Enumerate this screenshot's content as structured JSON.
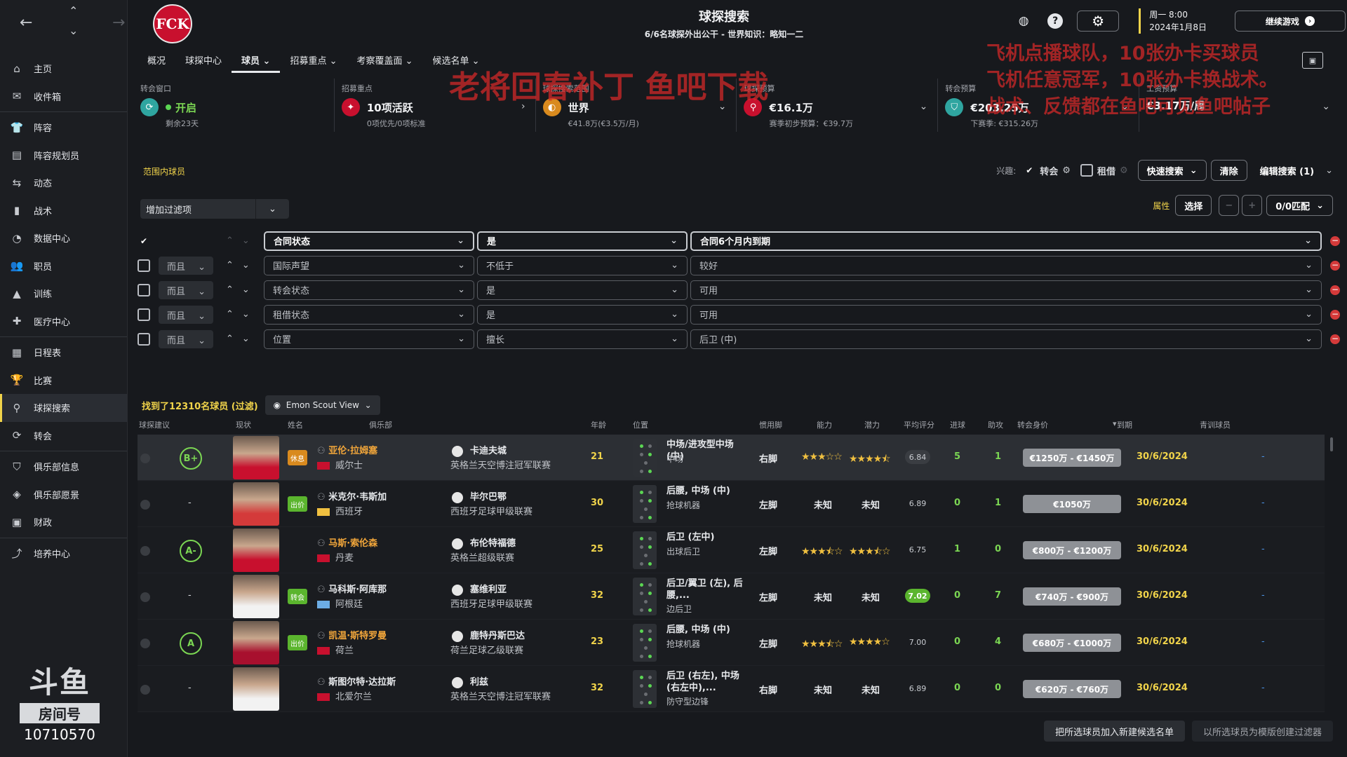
{
  "header": {
    "title": "球探搜索",
    "subtitle": "6/6名球探外出公干 - 世界知识：略知一二",
    "date_line1": "周一 8:00",
    "date_line2": "2024年1月8日",
    "continue_label": "继续游戏",
    "club_badge": "FCK"
  },
  "sidebar": {
    "items": [
      {
        "label": "主页",
        "icon": "home-icon",
        "glyph": "⌂"
      },
      {
        "label": "收件箱",
        "icon": "inbox-icon",
        "glyph": "✉"
      },
      {
        "label": "阵容",
        "icon": "shirt-icon",
        "glyph": "👕"
      },
      {
        "label": "阵容规划员",
        "icon": "clipboard-icon",
        "glyph": "▤"
      },
      {
        "label": "动态",
        "icon": "dynamics-icon",
        "glyph": "⇆"
      },
      {
        "label": "战术",
        "icon": "tactics-icon",
        "glyph": "▮"
      },
      {
        "label": "数据中心",
        "icon": "data-icon",
        "glyph": "◔"
      },
      {
        "label": "职员",
        "icon": "staff-icon",
        "glyph": "👥"
      },
      {
        "label": "训练",
        "icon": "training-icon",
        "glyph": "▲"
      },
      {
        "label": "医疗中心",
        "icon": "medical-icon",
        "glyph": "✚"
      },
      {
        "label": "日程表",
        "icon": "calendar-icon",
        "glyph": "▦"
      },
      {
        "label": "比赛",
        "icon": "trophy-icon",
        "glyph": "🏆"
      },
      {
        "label": "球探搜索",
        "icon": "search-icon",
        "glyph": "⚲"
      },
      {
        "label": "转会",
        "icon": "transfer-icon",
        "glyph": "⟳"
      },
      {
        "label": "俱乐部信息",
        "icon": "shield-icon",
        "glyph": "⛉"
      },
      {
        "label": "俱乐部愿景",
        "icon": "vision-icon",
        "glyph": "◈"
      },
      {
        "label": "财政",
        "icon": "finance-icon",
        "glyph": "▣"
      },
      {
        "label": "培养中心",
        "icon": "development-icon",
        "glyph": "⤴"
      }
    ],
    "watermark_room": "房间号",
    "watermark_number": "10710570",
    "watermark_logo": "斗鱼"
  },
  "tabs": [
    {
      "label": "概况"
    },
    {
      "label": "球探中心"
    },
    {
      "label": "球员 ⌄"
    },
    {
      "label": "招募重点 ⌄"
    },
    {
      "label": "考察覆盖面 ⌄"
    },
    {
      "label": "候选名单 ⌄"
    }
  ],
  "stats": [
    {
      "label": "转会窗口",
      "value": "开启",
      "sub": "剩余23天",
      "color": "#2fa5a0"
    },
    {
      "label": "招募重点",
      "value": "10项活跃",
      "sub": "0项优先/0项标准",
      "color": "#c8102e"
    },
    {
      "label": "球探搜索范围",
      "value": "世界",
      "sub": "€41.8万(€3.5万/月)",
      "color": "#d98a1e"
    },
    {
      "label": "球探预算",
      "value": "€16.1万",
      "sub": "赛季初步预算：€39.7万",
      "color": "#c8102e"
    },
    {
      "label": "转会预算",
      "value": "€203.25万",
      "sub": "下赛季: €315.26万",
      "color": "#2fa5a0"
    },
    {
      "label": "工资预算",
      "value": "€3.17万/周",
      "sub": "",
      "color": ""
    }
  ],
  "overlay": {
    "line1": "老将回春补丁   鱼吧下载",
    "line2": "飞机点播球队，10张办卡买球员",
    "line3": "飞机任意冠军，10张办卡换战术。",
    "line4": "战术、反馈都在鱼吧可见鱼吧帖子"
  },
  "controls": {
    "section_label": "范围内球员",
    "interest_label": "兴趣:",
    "transfer_label": "转会",
    "loan_label": "租借",
    "quick_search": "快速搜索",
    "clear": "清除",
    "edit_search": "编辑搜索 (1)",
    "add_filter": "增加过滤项",
    "attr_label": "属性",
    "select": "选择",
    "match": "0/0匹配"
  },
  "filters": [
    {
      "and": "",
      "field": "合同状态",
      "op": "是",
      "value": "合同6个月内到期",
      "on": true
    },
    {
      "and": "而且",
      "field": "国际声望",
      "op": "不低于",
      "value": "较好",
      "on": false
    },
    {
      "and": "而且",
      "field": "转会状态",
      "op": "是",
      "value": "可用",
      "on": false
    },
    {
      "and": "而且",
      "field": "租借状态",
      "op": "是",
      "value": "可用",
      "on": false
    },
    {
      "and": "而且",
      "field": "位置",
      "op": "擅长",
      "value": "后卫 (中)",
      "on": false
    }
  ],
  "results": {
    "found": "找到了12310名球员 (过滤)",
    "view": "Emon Scout View"
  },
  "columns": [
    "球探建议",
    "现状",
    "姓名",
    "俱乐部",
    "年龄",
    "位置",
    "惯用脚",
    "能力",
    "潜力",
    "平均评分",
    "进球",
    "助攻",
    "转会身价",
    "到期",
    "青训球员"
  ],
  "players": [
    {
      "grade": "B+",
      "status": "休息",
      "status_color": "#d98a1e",
      "name": "亚伦·拉姆塞",
      "nation": "威尔士",
      "flag": "#c8102e",
      "club": "卡迪夫城",
      "league": "英格兰天空博注冠军联赛",
      "age": "21",
      "pos": "中场/进攻型中场 (中)",
      "role": "中场",
      "foot": "右脚",
      "ability_stars": 3,
      "potential_stars": 4.5,
      "rating": "6.84",
      "rating_type": "mid",
      "goals": "5",
      "assists": "1",
      "value": "€1250万 - €1450万",
      "expiry": "30/6/2024",
      "youth": "-",
      "shirt": "#c8102e",
      "hl": true
    },
    {
      "grade": "-",
      "status": "出价",
      "status_color": "#5bb52e",
      "name": "米克尔·韦斯加",
      "nation": "西班牙",
      "flag": "#f0c040",
      "club": "毕尔巴鄂",
      "league": "西班牙足球甲级联赛",
      "age": "30",
      "pos": "后腰, 中场 (中)",
      "role": "抢球机器",
      "foot": "左脚",
      "ability_stars": 0,
      "potential_stars": 0,
      "rating": "6.89",
      "rating_type": "",
      "goals": "0",
      "assists": "1",
      "value": "€1050万",
      "expiry": "30/6/2024",
      "youth": "-",
      "shirt": "#d43a3a",
      "hl": false
    },
    {
      "grade": "A-",
      "status": "",
      "status_color": "",
      "name": "马斯·索伦森",
      "nation": "丹麦",
      "flag": "#c8102e",
      "club": "布伦特福德",
      "league": "英格兰超级联赛",
      "age": "25",
      "pos": "后卫 (左中)",
      "role": "出球后卫",
      "foot": "左脚",
      "ability_stars": 3.5,
      "potential_stars": 3.5,
      "rating": "6.75",
      "rating_type": "",
      "goals": "1",
      "assists": "0",
      "value": "€800万 - €1200万",
      "expiry": "30/6/2024",
      "youth": "-",
      "shirt": "#c8102e",
      "hl": true
    },
    {
      "grade": "-",
      "status": "转会",
      "status_color": "#5bb52e",
      "name": "马科斯·阿库那",
      "nation": "阿根廷",
      "flag": "#6cace4",
      "club": "塞维利亚",
      "league": "西班牙足球甲级联赛",
      "age": "32",
      "pos": "后卫/翼卫 (左), 后腰,...",
      "role": "边后卫",
      "foot": "左脚",
      "ability_stars": 0,
      "potential_stars": 0,
      "rating": "7.02",
      "rating_type": "good",
      "goals": "0",
      "assists": "7",
      "value": "€740万 - €900万",
      "expiry": "30/6/2024",
      "youth": "-",
      "shirt": "#f2f2f2",
      "hl": false
    },
    {
      "grade": "A",
      "status": "出价",
      "status_color": "#5bb52e",
      "name": "凯温·斯特罗曼",
      "nation": "荷兰",
      "flag": "#c8102e",
      "club": "鹿特丹斯巴达",
      "league": "荷兰足球乙级联赛",
      "age": "23",
      "pos": "后腰, 中场 (中)",
      "role": "抢球机器",
      "foot": "左脚",
      "ability_stars": 3.5,
      "potential_stars": 4,
      "rating": "7.00",
      "rating_type": "",
      "goals": "0",
      "assists": "4",
      "value": "€680万 - €1000万",
      "expiry": "30/6/2024",
      "youth": "-",
      "shirt": "#a8102e",
      "hl": true
    },
    {
      "grade": "-",
      "status": "",
      "status_color": "",
      "name": "斯图尔特·达拉斯",
      "nation": "北爱尔兰",
      "flag": "#c8102e",
      "club": "利兹",
      "league": "英格兰天空博注冠军联赛",
      "age": "32",
      "pos": "后卫 (右左), 中场 (右左中),...",
      "role": "防守型边锋",
      "foot": "右脚",
      "ability_stars": 0,
      "potential_stars": 0,
      "rating": "6.89",
      "rating_type": "",
      "goals": "0",
      "assists": "0",
      "value": "€620万 - €760万",
      "expiry": "30/6/2024",
      "youth": "-",
      "shirt": "#f2f2f2",
      "hl": false
    }
  ],
  "unknown_label": "未知",
  "bottom": {
    "btn1": "把所选球员加入新建候选名单",
    "btn2": "以所选球员为模版创建过滤器"
  }
}
